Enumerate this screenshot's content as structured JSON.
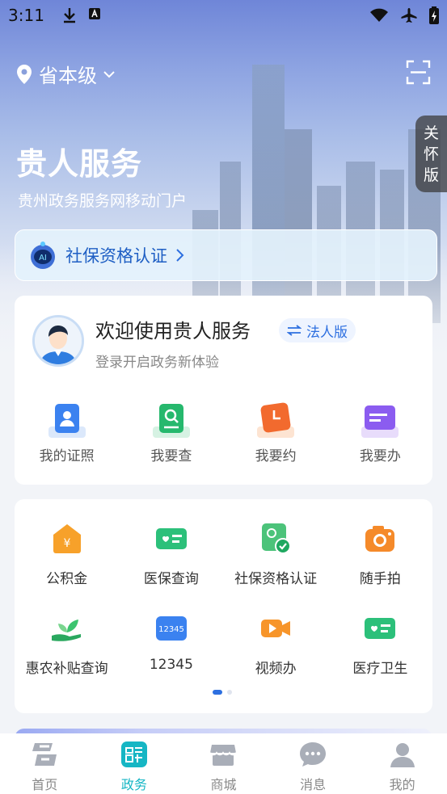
{
  "status_bar": {
    "time": "3:11"
  },
  "header": {
    "location": "省本级",
    "care_mode": [
      "关",
      "怀",
      "版"
    ],
    "title": "贵人服务",
    "subtitle": "贵州政务服务网移动门户"
  },
  "ai_banner": {
    "label": "社保资格认证",
    "icon_text": "AI"
  },
  "welcome_card": {
    "title": "欢迎使用贵人服务",
    "legal_button": "法人版",
    "subtitle": "登录开启政务新体验",
    "quick_actions": [
      {
        "label": "我的证照",
        "icon": "id-card-icon"
      },
      {
        "label": "我要查",
        "icon": "search-doc-icon"
      },
      {
        "label": "我要约",
        "icon": "appointment-clock-icon"
      },
      {
        "label": "我要办",
        "icon": "folder-icon"
      }
    ]
  },
  "services": {
    "items": [
      {
        "label": "公积金",
        "icon": "housing-fund-icon"
      },
      {
        "label": "医保查询",
        "icon": "medical-insurance-card-icon"
      },
      {
        "label": "社保资格认证",
        "icon": "social-security-cert-icon"
      },
      {
        "label": "随手拍",
        "icon": "camera-icon"
      },
      {
        "label": "惠农补贴查询",
        "icon": "sprout-hand-icon"
      },
      {
        "label": "12345",
        "icon": "hotline-12345-icon",
        "icon_text": "12345"
      },
      {
        "label": "视频办",
        "icon": "video-camera-icon"
      },
      {
        "label": "医疗卫生",
        "icon": "health-card-icon"
      }
    ],
    "page_indicator": {
      "current": 1,
      "total": 2
    }
  },
  "tabbar": {
    "items": [
      {
        "label": "首页",
        "icon": "home-logo-icon",
        "active": false
      },
      {
        "label": "政务",
        "icon": "government-icon",
        "active": true
      },
      {
        "label": "商城",
        "icon": "shop-icon",
        "active": false
      },
      {
        "label": "消息",
        "icon": "message-icon",
        "active": false
      },
      {
        "label": "我的",
        "icon": "profile-icon",
        "active": false
      }
    ]
  },
  "colors": {
    "accent": "#2d6fe0",
    "tab_active": "#16b6c4"
  }
}
